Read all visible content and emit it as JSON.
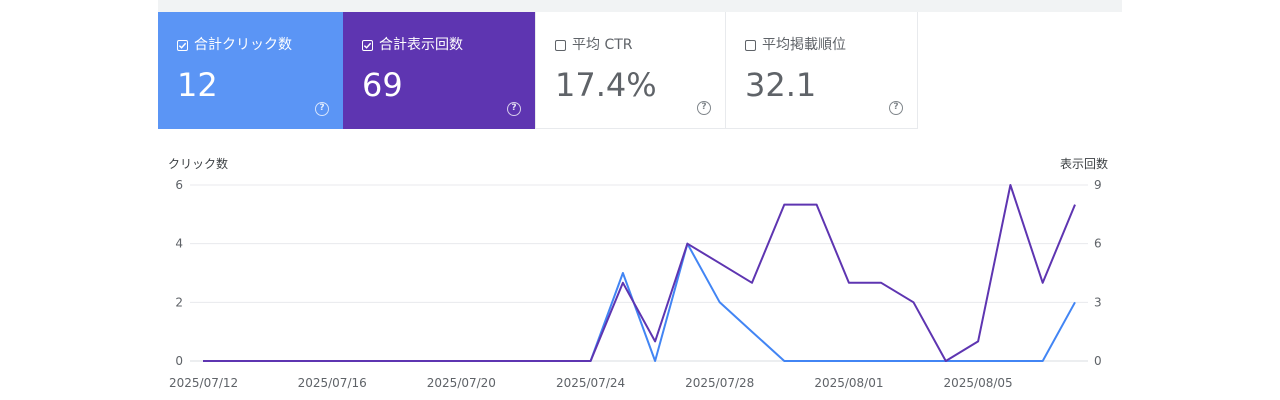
{
  "cards": [
    {
      "label": "合計クリック数",
      "value": "12",
      "checked": true,
      "color": "#5b95f5"
    },
    {
      "label": "合計表示回数",
      "value": "69",
      "checked": true,
      "color": "#5e35b1"
    },
    {
      "label": "平均 CTR",
      "value": "17.4%",
      "checked": false
    },
    {
      "label": "平均掲載順位",
      "value": "32.1",
      "checked": false
    }
  ],
  "help_glyph": "?",
  "chart_data": {
    "type": "line",
    "x": [
      "2025/07/12",
      "2025/07/13",
      "2025/07/14",
      "2025/07/15",
      "2025/07/16",
      "2025/07/17",
      "2025/07/18",
      "2025/07/19",
      "2025/07/20",
      "2025/07/21",
      "2025/07/22",
      "2025/07/23",
      "2025/07/24",
      "2025/07/25",
      "2025/07/26",
      "2025/07/27",
      "2025/07/28",
      "2025/07/29",
      "2025/07/30",
      "2025/07/31",
      "2025/08/01",
      "2025/08/02",
      "2025/08/03",
      "2025/08/04",
      "2025/08/05",
      "2025/08/06",
      "2025/08/07",
      "2025/08/08"
    ],
    "x_ticks": [
      "2025/07/12",
      "2025/07/16",
      "2025/07/20",
      "2025/07/24",
      "2025/07/28",
      "2025/08/01",
      "2025/08/05"
    ],
    "left_axis": {
      "label": "クリック数",
      "ticks": [
        "0",
        "2",
        "4",
        "6"
      ],
      "range": [
        0,
        6
      ]
    },
    "right_axis": {
      "label": "表示回数",
      "ticks": [
        "0",
        "3",
        "6",
        "9"
      ],
      "range": [
        0,
        9
      ]
    },
    "series": [
      {
        "name": "合計クリック数",
        "axis": "left",
        "color": "#4285f4",
        "values": [
          0,
          0,
          0,
          0,
          0,
          0,
          0,
          0,
          0,
          0,
          0,
          0,
          0,
          3,
          0,
          4,
          2,
          1,
          0,
          0,
          0,
          0,
          0,
          0,
          0,
          0,
          0,
          2
        ]
      },
      {
        "name": "合計表示回数",
        "axis": "right",
        "color": "#5e35b1",
        "values": [
          0,
          0,
          0,
          0,
          0,
          0,
          0,
          0,
          0,
          0,
          0,
          0,
          0,
          4,
          1,
          6,
          5,
          4,
          8,
          8,
          4,
          4,
          3,
          0,
          1,
          9,
          4,
          8
        ]
      }
    ],
    "grid": true
  }
}
